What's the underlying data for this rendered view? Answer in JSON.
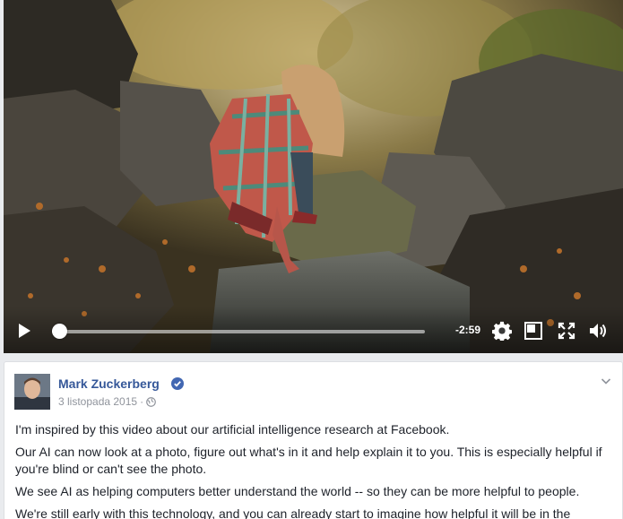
{
  "video": {
    "time_remaining": "-2:59",
    "progress_fraction": 0.02,
    "controls": [
      "play-icon",
      "settings-gear-icon",
      "mini-player-icon",
      "fullscreen-icon",
      "volume-icon"
    ]
  },
  "post": {
    "author": "Mark Zuckerberg",
    "date": "3 listopada 2015",
    "separator": "·",
    "paragraphs": [
      "I'm inspired by this video about our artificial intelligence research at Facebook.",
      "Our AI can now look at a photo, figure out what's in it and help explain it to you. This is especially helpful if you're blind or can't see the photo.",
      "We see AI as helping computers better understand the world -- so they can be more helpful to people.",
      "We're still early with this technology, and you can already start to imagine how helpful it will be in the"
    ]
  },
  "colors": {
    "link_blue": "#365899",
    "verified_blue": "#4267b2",
    "meta_gray": "#90949c",
    "text": "#1d2129"
  }
}
